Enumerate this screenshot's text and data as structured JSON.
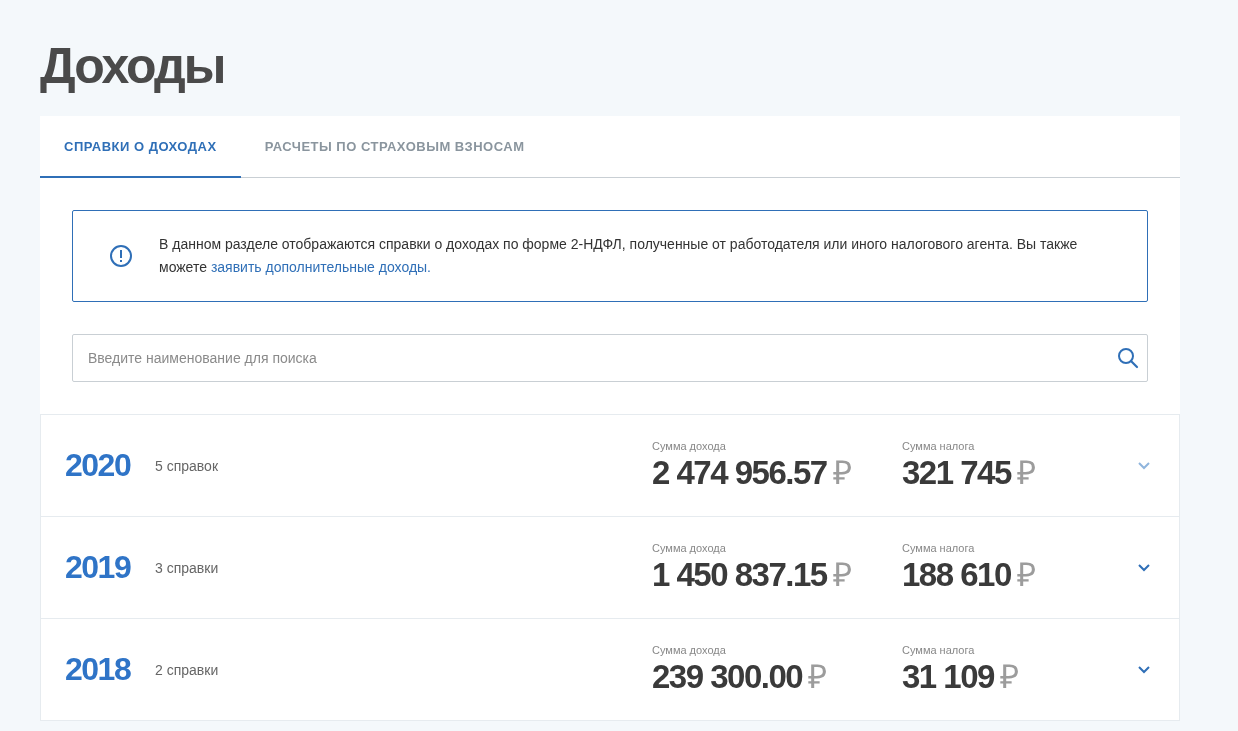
{
  "page": {
    "title": "Доходы"
  },
  "tabs": [
    {
      "label": "СПРАВКИ О ДОХОДАХ",
      "selected": true
    },
    {
      "label": "РАСЧЕТЫ ПО СТРАХОВЫМ ВЗНОСАМ",
      "selected": false
    }
  ],
  "notice": {
    "text": "В данном разделе отображаются справки о доходах по форме 2-НДФЛ, полученные от работодателя или иного налогового агента. Вы также можете ",
    "link": "заявить дополнительные доходы."
  },
  "search": {
    "placeholder": "Введите наименование для поиска"
  },
  "years": [
    {
      "year": "2020",
      "count": "5 справок",
      "income_label": "Сумма дохода",
      "income": "2 474 956.57",
      "income_currency": "₽",
      "tax_label": "Сумма налога",
      "tax": "321 745",
      "tax_currency": "₽",
      "hovered": true
    },
    {
      "year": "2019",
      "count": "3 справки",
      "income_label": "Сумма дохода",
      "income": "1 450 837.15",
      "income_currency": "₽",
      "tax_label": "Сумма налога",
      "tax": "188 610",
      "tax_currency": "₽",
      "hovered": false
    },
    {
      "year": "2018",
      "count": "2 справки",
      "income_label": "Сумма дохода",
      "income": "239 300.00",
      "income_currency": "₽",
      "tax_label": "Сумма налога",
      "tax": "31 109",
      "tax_currency": "₽",
      "hovered": false
    }
  ]
}
